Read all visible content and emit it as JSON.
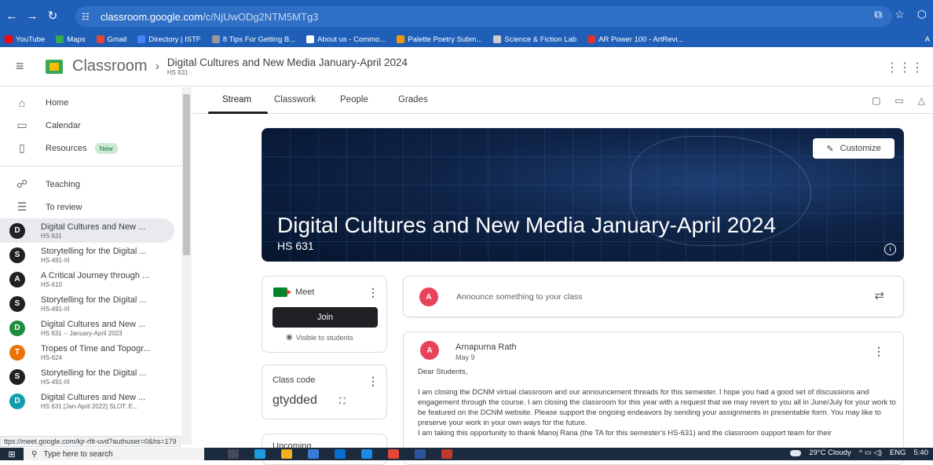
{
  "browser": {
    "url_domain": "classroom.google.com",
    "url_path": "/c/NjUwODg2NTM5MTg3",
    "bookmarks": [
      {
        "label": "YouTube",
        "color": "#ff0000"
      },
      {
        "label": "Maps",
        "color": "#34a853"
      },
      {
        "label": "Gmail",
        "color": "#ea4335"
      },
      {
        "label": "Directory | ISTF",
        "color": "#4285f4"
      },
      {
        "label": "8 Tips For Getting B...",
        "color": "#999999"
      },
      {
        "label": "About us - Commo...",
        "color": "#ffffff"
      },
      {
        "label": "Palette Poetry Subm...",
        "color": "#f29900"
      },
      {
        "label": "Science & Fiction Lab",
        "color": "#cccccc"
      },
      {
        "label": "AR Power 100 - ArtRevi...",
        "color": "#d33"
      }
    ],
    "bookmarks_overflow": "A",
    "status_url": "ttps://meet.google.com/kjr-rfit-uvd?authuser=0&hs=179"
  },
  "header": {
    "app_name": "Classroom",
    "breadcrumb_title": "Digital Cultures and New Media January-April 2024",
    "breadcrumb_sub": "HS 631"
  },
  "sidebar": {
    "home": "Home",
    "calendar": "Calendar",
    "resources": "Resources",
    "new_badge": "New",
    "teaching": "Teaching",
    "to_review": "To review",
    "classes": [
      {
        "letter": "D",
        "name": "Digital Cultures and New ...",
        "sub": "HS 631",
        "color": "#202124"
      },
      {
        "letter": "S",
        "name": "Storytelling for the Digital ...",
        "sub": "HS-491-III",
        "color": "#202124"
      },
      {
        "letter": "A",
        "name": "A Critical Journey through ...",
        "sub": "HS-610",
        "color": "#202124"
      },
      {
        "letter": "S",
        "name": "Storytelling for the Digital ...",
        "sub": "HS-491-III",
        "color": "#202124"
      },
      {
        "letter": "D",
        "name": "Digital Cultures and New ...",
        "sub": "HS 631 -- January-April 2023",
        "color": "#1e8e3e"
      },
      {
        "letter": "T",
        "name": "Tropes of Time and Topogr...",
        "sub": "HS-624",
        "color": "#e8710a"
      },
      {
        "letter": "S",
        "name": "Storytelling for the Digital ...",
        "sub": "HS-491-III",
        "color": "#202124"
      },
      {
        "letter": "D",
        "name": "Digital Cultures and New ...",
        "sub": "HS 631 [Jan-April 2022] SLOT: E...",
        "color": "#129eaf"
      }
    ]
  },
  "tabs": [
    "Stream",
    "Classwork",
    "People",
    "Grades"
  ],
  "banner": {
    "title": "Digital Cultures and New Media January-April 2024",
    "code": "HS 631",
    "customize_label": "Customize"
  },
  "meet": {
    "label": "Meet",
    "join_label": "Join",
    "visible_label": "Visible to students"
  },
  "class_code": {
    "label": "Class code",
    "value": "gtydded"
  },
  "upcoming": {
    "label": "Upcoming"
  },
  "announce": {
    "avatar_letter": "A",
    "placeholder": "Announce something to your class"
  },
  "post": {
    "avatar_letter": "A",
    "author": "Arnapurna Rath",
    "date": "May 9",
    "greeting": "Dear Students,",
    "paragraph1": "I am closing the DCNM virtual classroom and our announcement threads for this semester. I hope you had a good set of discussions and engagement through the course. I am closing the classroom for this year with a request that we may revert to you all in June/July for your work to be featured on the DCNM website. Please support the ongoing endeavors by sending your assignments in presentable form. You may like to preserve your work in your own ways for the future.",
    "paragraph2": "I am taking this opportunity to thank Manoj Rana (the TA for this semester's HS-631) and the classroom support team for their"
  },
  "taskbar": {
    "search_placeholder": "Type here to search",
    "weather": "29°C Cloudy",
    "lang": "ENG",
    "time": "5:40"
  }
}
